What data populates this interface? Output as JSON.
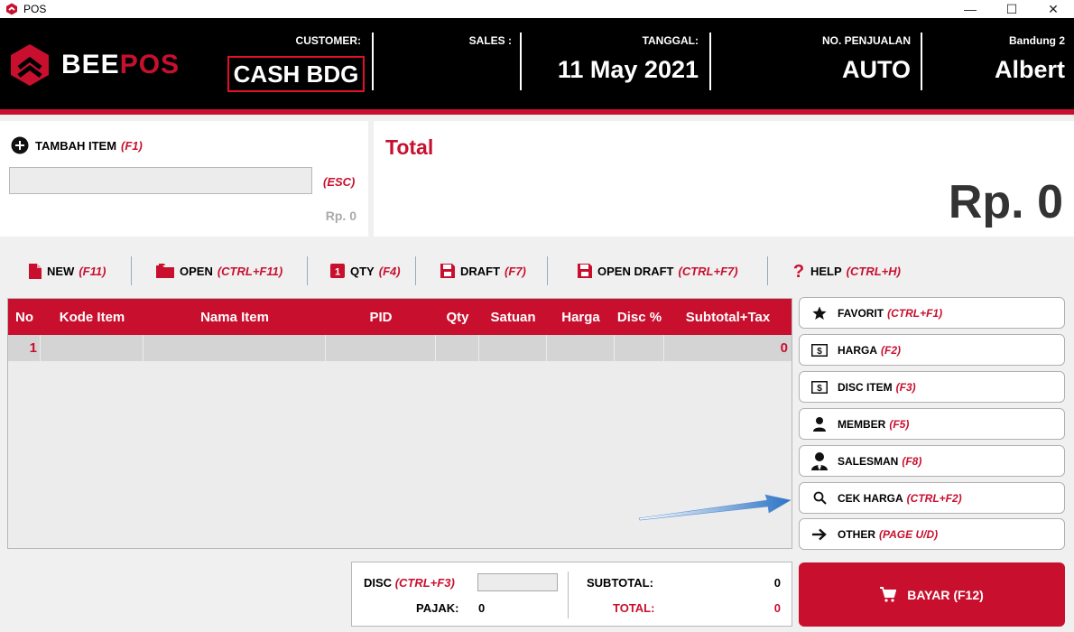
{
  "window": {
    "title": "POS",
    "minimize": "—",
    "maximize": "☐",
    "close": "✕"
  },
  "header": {
    "logo_white": "BEE",
    "logo_red": "POS",
    "customer_label": "CUSTOMER:",
    "customer_value": "CASH BDG",
    "sales_label": "SALES :",
    "sales_value": "",
    "date_label": "TANGGAL:",
    "date_value": "11 May 2021",
    "sale_no_label": "NO. PENJUALAN",
    "sale_no_value": "AUTO",
    "branch_label": "Bandung 2",
    "cashier_value": "Albert"
  },
  "add_item": {
    "label": "TAMBAH ITEM",
    "shortcut": "(F1)",
    "input_value": "",
    "esc": "(ESC)",
    "price": "Rp. 0"
  },
  "total": {
    "label": "Total",
    "value": "Rp. 0"
  },
  "toolbar": [
    {
      "label": "NEW",
      "shortcut": "(F11)"
    },
    {
      "label": "OPEN",
      "shortcut": "(CTRL+F11)"
    },
    {
      "label": "QTY",
      "shortcut": "(F4)"
    },
    {
      "label": "DRAFT",
      "shortcut": "(F7)"
    },
    {
      "label": "OPEN DRAFT",
      "shortcut": "(CTRL+F7)"
    },
    {
      "label": "HELP",
      "shortcut": "(CTRL+H)"
    }
  ],
  "table": {
    "headers": [
      "No",
      "Kode Item",
      "Nama Item",
      "PID",
      "Qty",
      "Satuan",
      "Harga",
      "Disc %",
      "Subtotal+Tax"
    ],
    "rows": [
      {
        "no": "1",
        "kode": "",
        "nama": "",
        "pid": "",
        "qty": "",
        "satuan": "",
        "harga": "",
        "disc": "",
        "subtotal": "0"
      }
    ]
  },
  "side_buttons": [
    {
      "label": "FAVORIT",
      "shortcut": "(CTRL+F1)",
      "icon": "star-icon"
    },
    {
      "label": "HARGA",
      "shortcut": "(F2)",
      "icon": "price-tag-icon"
    },
    {
      "label": "DISC ITEM",
      "shortcut": "(F3)",
      "icon": "price-tag-icon"
    },
    {
      "label": "MEMBER",
      "shortcut": "(F5)",
      "icon": "user-icon"
    },
    {
      "label": "SALESMAN",
      "shortcut": "(F8)",
      "icon": "salesman-icon"
    },
    {
      "label": "CEK HARGA",
      "shortcut": "(CTRL+F2)",
      "icon": "search-icon"
    },
    {
      "label": "OTHER",
      "shortcut": "(PAGE U/D)",
      "icon": "arrow-right-icon"
    }
  ],
  "summary": {
    "disc_label": "DISC",
    "disc_shortcut": "(CTRL+F3)",
    "disc_value": "",
    "pajak_label": "PAJAK:",
    "pajak_value": "0",
    "subtotal_label": "SUBTOTAL:",
    "subtotal_value": "0",
    "total_label": "TOTAL:",
    "total_value": "0"
  },
  "pay_button": {
    "label": "BAYAR (F12)"
  },
  "colors": {
    "brand_red": "#c8102e",
    "header_bg": "#000000"
  }
}
